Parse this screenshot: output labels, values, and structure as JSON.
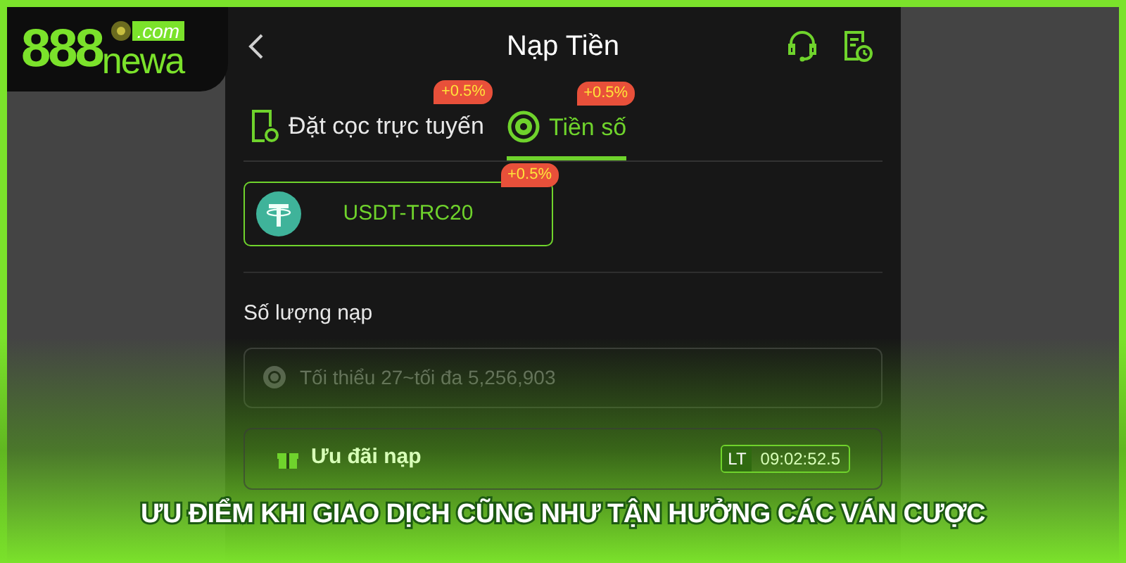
{
  "logo": {
    "digits": "888",
    "domain": ".com",
    "name": "newa"
  },
  "header": {
    "title": "Nạp Tiền"
  },
  "tabs": [
    {
      "label": "Đặt cọc trực tuyến",
      "badge": "+0.5%",
      "selected": false,
      "kind": "phone"
    },
    {
      "label": "Tiền số",
      "badge": "+0.5%",
      "selected": true,
      "kind": "coin"
    }
  ],
  "methods": [
    {
      "label": "USDT-TRC20",
      "badge": "+0.5%",
      "selected": true
    }
  ],
  "amount": {
    "label": "Số lượng nạp",
    "placeholder": "Tối thiểu 27~tối đa 5,256,903"
  },
  "offer": {
    "label": "Ưu đãi nạp",
    "tag": "LT",
    "timer": "09:02:52.5"
  },
  "caption": "ƯU ĐIỂM KHI GIAO DỊCH CŨNG NHƯ TẬN HƯỞNG CÁC VÁN CƯỢC"
}
